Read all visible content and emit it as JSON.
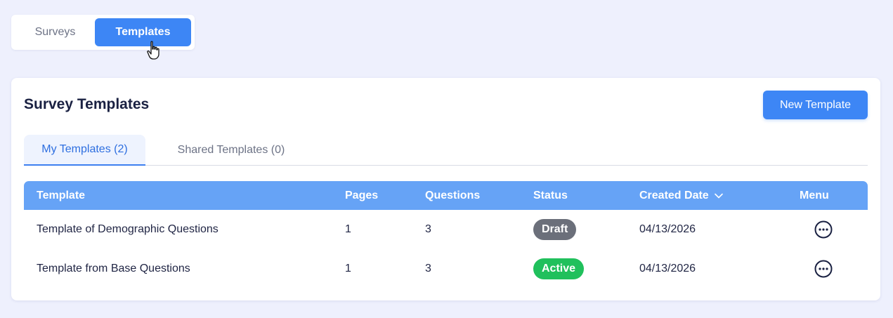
{
  "topnav": {
    "surveys_label": "Surveys",
    "templates_label": "Templates"
  },
  "card": {
    "title": "Survey Templates",
    "new_button": "New Template"
  },
  "tabs": {
    "my": "My Templates (2)",
    "shared": "Shared Templates (0)"
  },
  "table": {
    "headers": {
      "template": "Template",
      "pages": "Pages",
      "questions": "Questions",
      "status": "Status",
      "created": "Created Date",
      "menu": "Menu"
    },
    "rows": [
      {
        "template": "Template of Demographic Questions",
        "pages": "1",
        "questions": "3",
        "status": "Draft",
        "created": "04/13/2026"
      },
      {
        "template": "Template from Base Questions",
        "pages": "1",
        "questions": "3",
        "status": "Active",
        "created": "04/13/2026"
      }
    ]
  },
  "colors": {
    "accent": "#3d86f5",
    "header_bg": "#66a3f6",
    "draft": "#6b6f7a",
    "active": "#20c05c"
  },
  "icons": {
    "sort": "chevron-down-icon",
    "menu": "more-horizontal-circle-icon",
    "cursor": "hand-pointer-icon"
  }
}
